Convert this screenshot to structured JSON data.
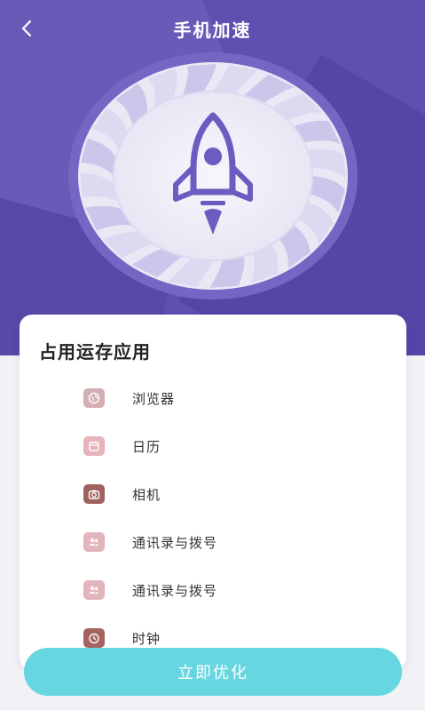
{
  "header": {
    "title": "手机加速"
  },
  "panel": {
    "title": "占用运存应用",
    "apps": [
      {
        "name": "浏览器",
        "icon": "globe-icon",
        "icon_bg": "#d3aeb2",
        "icon_fg": "#ffffff"
      },
      {
        "name": "日历",
        "icon": "calendar-icon",
        "icon_bg": "#e7b3bb",
        "icon_fg": "#ffffff"
      },
      {
        "name": "相机",
        "icon": "camera-icon",
        "icon_bg": "#a0625f",
        "icon_fg": "#ffffff"
      },
      {
        "name": "通讯录与拨号",
        "icon": "contacts-icon",
        "icon_bg": "#e2b5bc",
        "icon_fg": "#ffffff"
      },
      {
        "name": "通讯录与拨号",
        "icon": "contacts-icon",
        "icon_bg": "#e2b5bc",
        "icon_fg": "#ffffff"
      },
      {
        "name": "时钟",
        "icon": "clock-icon",
        "icon_bg": "#a6625f",
        "icon_fg": "#ffffff"
      }
    ]
  },
  "cta": {
    "label": "立即优化"
  },
  "colors": {
    "header_bg": "#5f4fb0",
    "rocket": "#6a5cc0",
    "cta_bg": "#66d7e0"
  }
}
